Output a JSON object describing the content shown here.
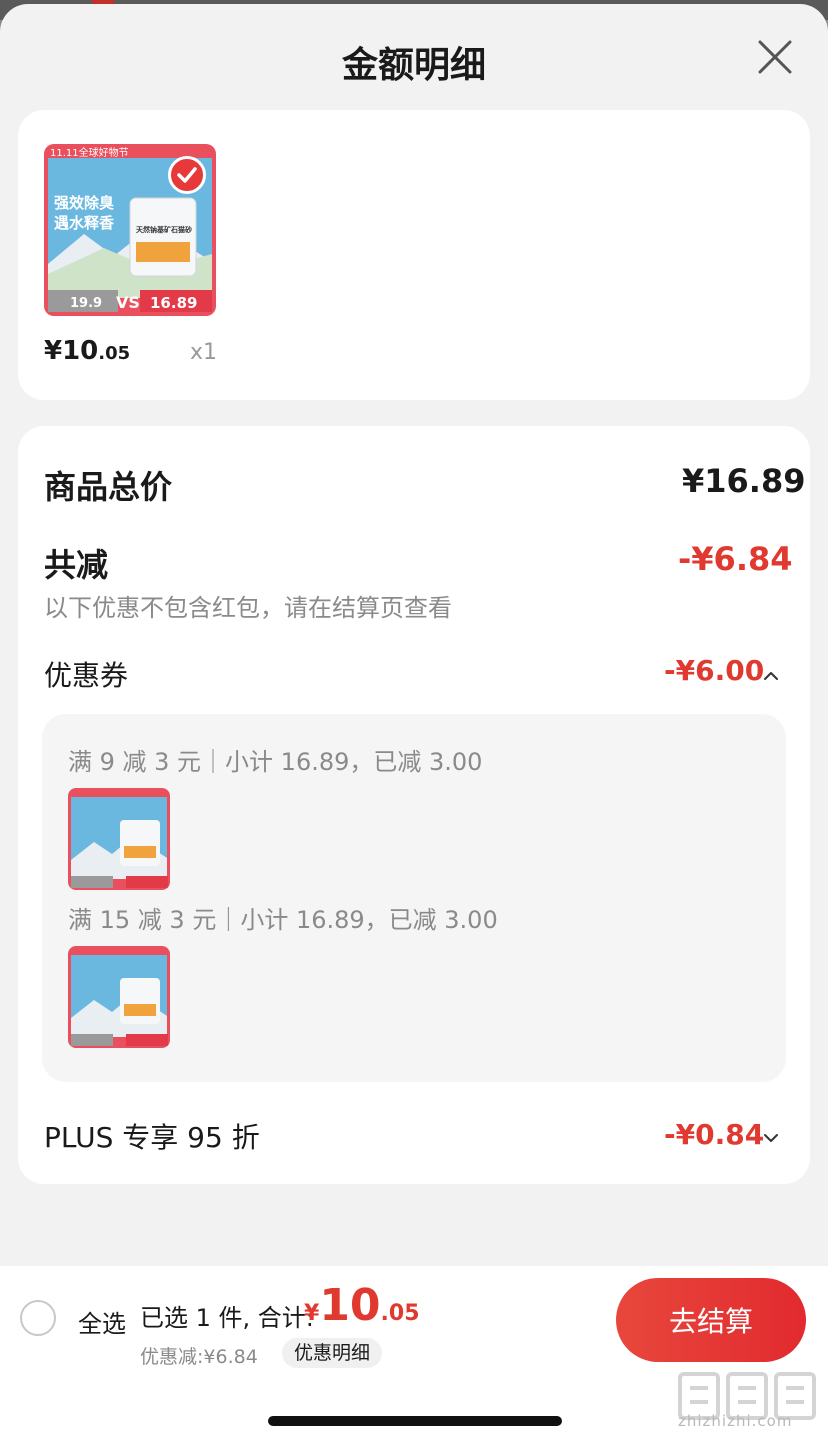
{
  "header": {
    "title": "金额明细"
  },
  "product": {
    "banner_text": "11.11全球好物节",
    "slogan_line1": "强效除臭",
    "slogan_line2": "遇水释香",
    "product_name": "天然钠基矿石猫砂",
    "old_price": "19.9",
    "vs": "VS",
    "new_price": "16.89",
    "price_yen": "¥",
    "price_int": "10",
    "price_dec": ".05",
    "qty": "x1"
  },
  "summary": {
    "total_label": "商品总价",
    "total_value": "¥16.89",
    "reduce_label": "共减",
    "reduce_value": "-¥6.84",
    "note": "以下优惠不包含红包，请在结算页查看",
    "coupon_label": "优惠券",
    "coupon_value": "-¥6.00",
    "coupons": [
      {
        "text": "满 9 减 3 元｜小计 16.89，已减 3.00"
      },
      {
        "text": "满 15 减 3 元｜小计 16.89，已减 3.00"
      }
    ],
    "plus_label": "PLUS 专享 95 折",
    "plus_value": "-¥0.84"
  },
  "bottom": {
    "select_all": "全选",
    "selected_text": "已选 1 件, 合计:",
    "total_yen": "¥",
    "total_int": "10",
    "total_dec": ".05",
    "discount_text": "优惠减:¥6.84",
    "detail_label": "优惠明细",
    "checkout_label": "去结算"
  },
  "watermark": {
    "text": "zhizhizhi.com"
  },
  "colors": {
    "accent": "#e0392f",
    "checkout": "#e22a2f",
    "card_bg": "#ffffff",
    "sheet_bg": "#f2f2f2"
  }
}
